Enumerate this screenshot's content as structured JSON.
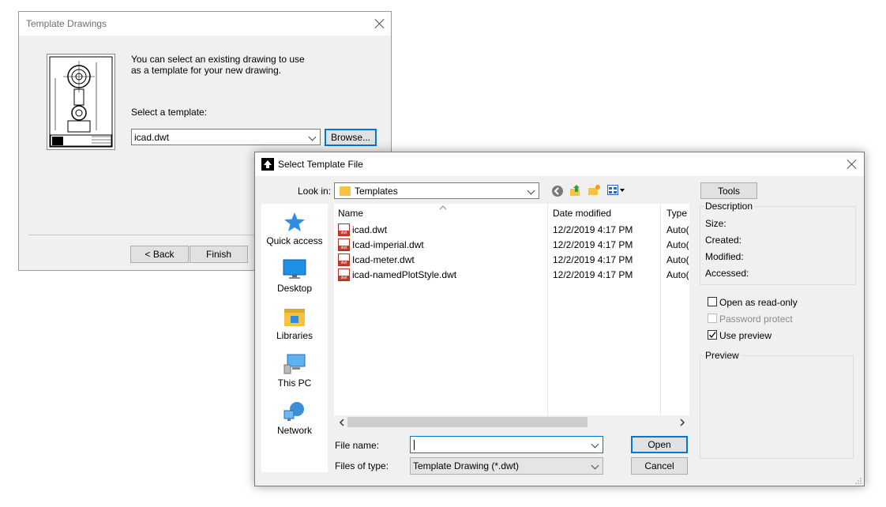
{
  "template_dialog": {
    "title": "Template Drawings",
    "intro_line1": "You can select an existing drawing to use",
    "intro_line2": "as a template for your new drawing.",
    "select_label": "Select a template:",
    "template_value": "icad.dwt",
    "browse_label": "Browse...",
    "back_label": "< Back",
    "finish_label": "Finish"
  },
  "file_dialog": {
    "title": "Select Template File",
    "look_in_label": "Look in:",
    "look_in_value": "Templates",
    "tools_label": "Tools",
    "places": [
      {
        "label": "Quick access",
        "icon": "star-icon"
      },
      {
        "label": "Desktop",
        "icon": "desktop-icon"
      },
      {
        "label": "Libraries",
        "icon": "libraries-icon"
      },
      {
        "label": "This PC",
        "icon": "computer-icon"
      },
      {
        "label": "Network",
        "icon": "network-icon"
      }
    ],
    "columns": {
      "name": "Name",
      "date": "Date modified",
      "type": "Type"
    },
    "files": [
      {
        "name": "icad.dwt",
        "date": "12/2/2019 4:17 PM",
        "type": "Auto("
      },
      {
        "name": "Icad-imperial.dwt",
        "date": "12/2/2019 4:17 PM",
        "type": "Auto("
      },
      {
        "name": "Icad-meter.dwt",
        "date": "12/2/2019 4:17 PM",
        "type": "Auto("
      },
      {
        "name": "icad-namedPlotStyle.dwt",
        "date": "12/2/2019 4:17 PM",
        "type": "Auto("
      }
    ],
    "file_name_label": "File name:",
    "file_name_value": "",
    "files_of_type_label": "Files of type:",
    "files_of_type_value": "Template Drawing (*.dwt)",
    "open_label": "Open",
    "cancel_label": "Cancel",
    "description": {
      "legend": "Description",
      "size_label": "Size:",
      "created_label": "Created:",
      "modified_label": "Modified:",
      "accessed_label": "Accessed:"
    },
    "options": {
      "read_only_label": "Open as read-only",
      "read_only_checked": false,
      "password_label": "Password protect",
      "password_enabled": false,
      "preview_label": "Use preview",
      "preview_checked": true
    },
    "preview_legend": "Preview"
  },
  "colors": {
    "accent": "#0078d7",
    "folder": "#f5c244",
    "dialog_bg": "#f0f0f0"
  }
}
